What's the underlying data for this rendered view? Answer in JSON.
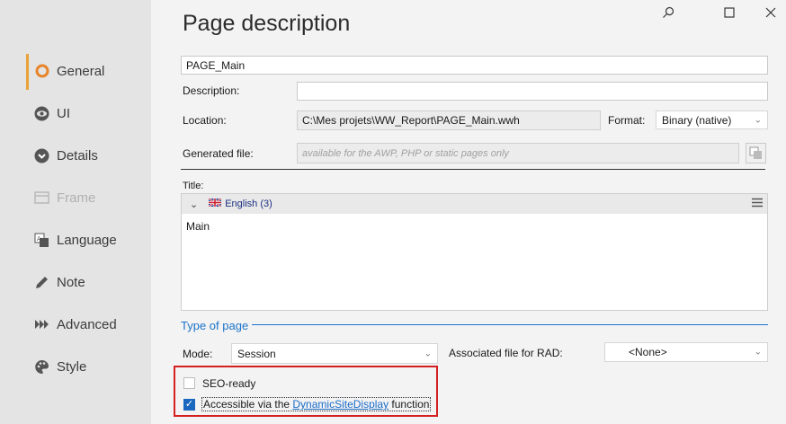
{
  "sidebar": {
    "items": [
      {
        "label": "General",
        "icon": "ring-icon",
        "active": true
      },
      {
        "label": "UI",
        "icon": "eye-icon"
      },
      {
        "label": "Details",
        "icon": "chevron-circle-icon"
      },
      {
        "label": "Frame",
        "icon": "frame-icon",
        "disabled": true
      },
      {
        "label": "Language",
        "icon": "translate-icon"
      },
      {
        "label": "Note",
        "icon": "pencil-icon"
      },
      {
        "label": "Advanced",
        "icon": "fast-forward-icon"
      },
      {
        "label": "Style",
        "icon": "palette-icon"
      }
    ],
    "accent": "#e8a33a"
  },
  "header": {
    "title": "Page description"
  },
  "form": {
    "name_value": "PAGE_Main",
    "description_label": "Description:",
    "description_value": "",
    "location_label": "Location:",
    "location_value": "C:\\Mes projets\\WW_Report\\PAGE_Main.wwh",
    "format_label": "Format:",
    "format_value": "Binary (native)",
    "generated_label": "Generated file:",
    "generated_placeholder": "available for the AWP, PHP or static pages only",
    "title_label": "Title:",
    "title_language": "English (3)",
    "title_value": "Main"
  },
  "type_of_page": {
    "section_title": "Type of page",
    "mode_label": "Mode:",
    "mode_value": "Session",
    "rad_label": "Associated file for RAD:",
    "rad_value": "<None>",
    "seo_label": "SEO-ready",
    "seo_checked": false,
    "accessible_prefix": "Accessible via the ",
    "accessible_link": "DynamicSiteDisplay",
    "accessible_suffix": " function",
    "accessible_checked": true
  },
  "colors": {
    "link": "#1a6cc9",
    "highlight": "#d42020",
    "section": "#1d73c9"
  }
}
